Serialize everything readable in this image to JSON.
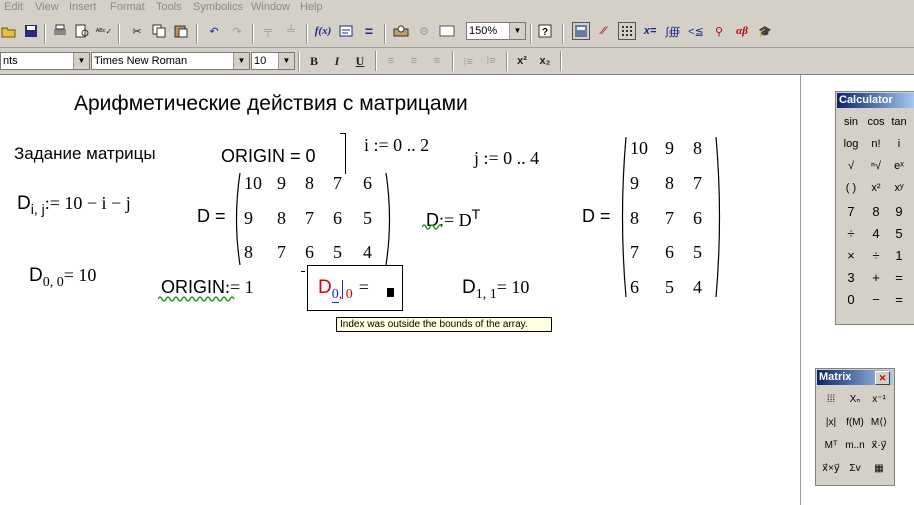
{
  "menu": [
    "Edit",
    "View",
    "Insert",
    "Format",
    "Tools",
    "Symbolics",
    "Window",
    "Help"
  ],
  "toolbar": {
    "zoom": "150%"
  },
  "format_bar": {
    "style": "nts",
    "font": "Times New Roman",
    "size": "10",
    "bold": "B",
    "italic": "I",
    "underline": "U"
  },
  "worksheet": {
    "heading": "Арифметические действия с матрицами",
    "matrix_label": "Задание матрицы",
    "origin_eval": "ORIGIN = 0",
    "i_range": "i := 0 .. 2",
    "j_range": "j := 0 .. 4",
    "def_lhs_D": "D",
    "def_lhs_sub": "i, j",
    "def_rhs": ":= 10 − i − j",
    "d_eq_label": "D =",
    "matrix_D": [
      [
        "10",
        "9",
        "8",
        "7",
        "6"
      ],
      [
        "9",
        "8",
        "7",
        "6",
        "5"
      ],
      [
        "8",
        "7",
        "6",
        "5",
        "4"
      ]
    ],
    "transpose_D": "D",
    "transpose_assign": ":= D",
    "transpose_sup": "T",
    "d_eq_label2": "D =",
    "matrix_DT": [
      [
        "10",
        "9",
        "8"
      ],
      [
        "9",
        "8",
        "7"
      ],
      [
        "8",
        "7",
        "6"
      ],
      [
        "7",
        "6",
        "5"
      ],
      [
        "6",
        "5",
        "4"
      ]
    ],
    "d00_D": "D",
    "d00_sub": "0, 0",
    "d00_val": "= 10",
    "origin_assign_name": "ORIGIN",
    "origin_assign_val": ":= 1",
    "err_D": "D",
    "err_sub1": "0",
    "err_sub2": ", 0",
    "err_eq": "=",
    "d11_D": "D",
    "d11_sub": "1, 1",
    "d11_val": "= 10",
    "error_tooltip": "Index was outside the bounds of the array."
  },
  "calculator": {
    "title": "Calculator",
    "rows": [
      [
        "sin",
        "cos",
        "tan"
      ],
      [
        "log",
        "n!",
        "i"
      ],
      [
        "√",
        "ⁿ√",
        "eˣ"
      ],
      [
        "( )",
        "x²",
        "xʸ"
      ],
      [
        "7",
        "8",
        "9"
      ],
      [
        "÷",
        "4",
        "5"
      ],
      [
        "×",
        "÷",
        "1"
      ],
      [
        "3",
        "+",
        "="
      ],
      [
        "0",
        "−",
        "="
      ]
    ]
  },
  "matrix_palette": {
    "title": "Matrix",
    "close": "✕",
    "buttons": [
      [
        "⁞⁞⁞",
        "Xₙ",
        "x⁻¹"
      ],
      [
        "|x|",
        "f(M)",
        "M⟨⟩"
      ],
      [
        "Mᵀ",
        "m..n",
        "x⃗·y⃗"
      ],
      [
        "x⃗×y⃗",
        "Σv",
        "▦"
      ]
    ]
  }
}
